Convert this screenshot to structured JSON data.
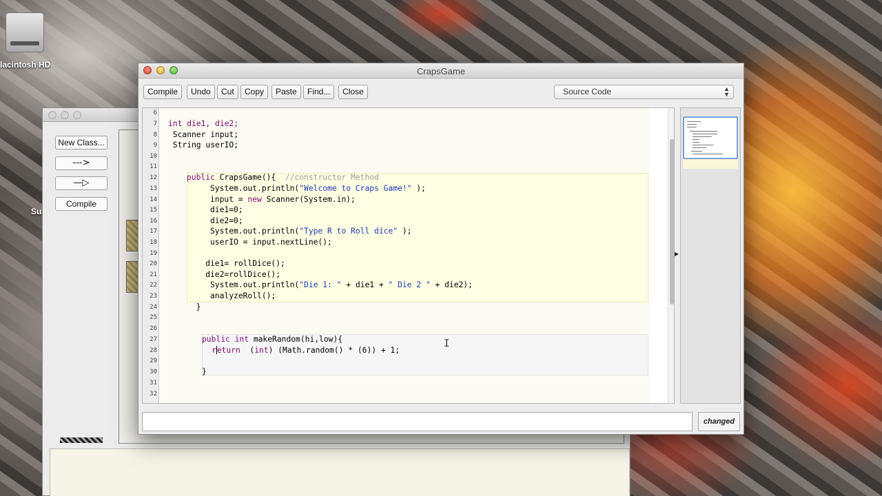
{
  "desktop": {
    "hd_label": "lacintosh HD",
    "su_label": "Su"
  },
  "bg_window": {
    "buttons": [
      "New Class...",
      "--->",
      "—▷",
      "Compile"
    ]
  },
  "editor": {
    "title": "CrapsGame",
    "toolbar": {
      "compile": "Compile",
      "undo": "Undo",
      "cut": "Cut",
      "copy": "Copy",
      "paste": "Paste",
      "find": "Find...",
      "close": "Close"
    },
    "view_select": "Source Code",
    "status": "changed",
    "line_numbers": [
      "6",
      "7",
      "8",
      "9",
      "10",
      "11",
      "12",
      "13",
      "14",
      "15",
      "16",
      "17",
      "18",
      "19",
      "20",
      "21",
      "22",
      "23",
      "24",
      "25",
      "26",
      "27",
      "28",
      "29",
      "30",
      "31",
      "32"
    ]
  },
  "code": {
    "l7": "int die1, die2;",
    "l8": " Scanner input;",
    "l9": " String userIO;",
    "l12_kw": "public",
    "l12_rest": " CrapsGame(){  ",
    "l12_cmt": "//constructor Method",
    "l13_a": "     System.out.println(",
    "l13_str": "\"Welcome to Craps Game!\"",
    "l13_b": " );",
    "l14_a": "     input = ",
    "l14_kw": "new",
    "l14_b": " Scanner(System.in);",
    "l15": "     die1=0;",
    "l16": "     die2=0;",
    "l17_a": "     System.out.println(",
    "l17_str": "\"Type R to Roll dice\"",
    "l17_b": " );",
    "l18": "     userIO = input.nextLine();",
    "l20": "    die1= rollDice();",
    "l21": "    die2=rollDice();",
    "l22_a": "     System.out.println(",
    "l22_str1": "\"Die 1: \"",
    "l22_b": " + die1 + ",
    "l22_str2": "\" Die 2 \"",
    "l22_c": " + die2);",
    "l23": "     analyzeRoll();",
    "l24": "  }",
    "l27_kw1": "public",
    "l27_kw2": "int",
    "l27_rest": " makeRandom(hi,low){",
    "l28_r": "r",
    "l28_kw": "eturn",
    "l28_a": "  (",
    "l28_kw2": "int",
    "l28_b": ") (Math.random() * (6)) + 1;",
    "l30": "}"
  },
  "colors": {
    "keyword": "#7a0874",
    "string": "#1b3bb3",
    "comment": "#9a9a9a",
    "class_scope": "#fbfbf1",
    "method_scope": "#ffffe4"
  }
}
